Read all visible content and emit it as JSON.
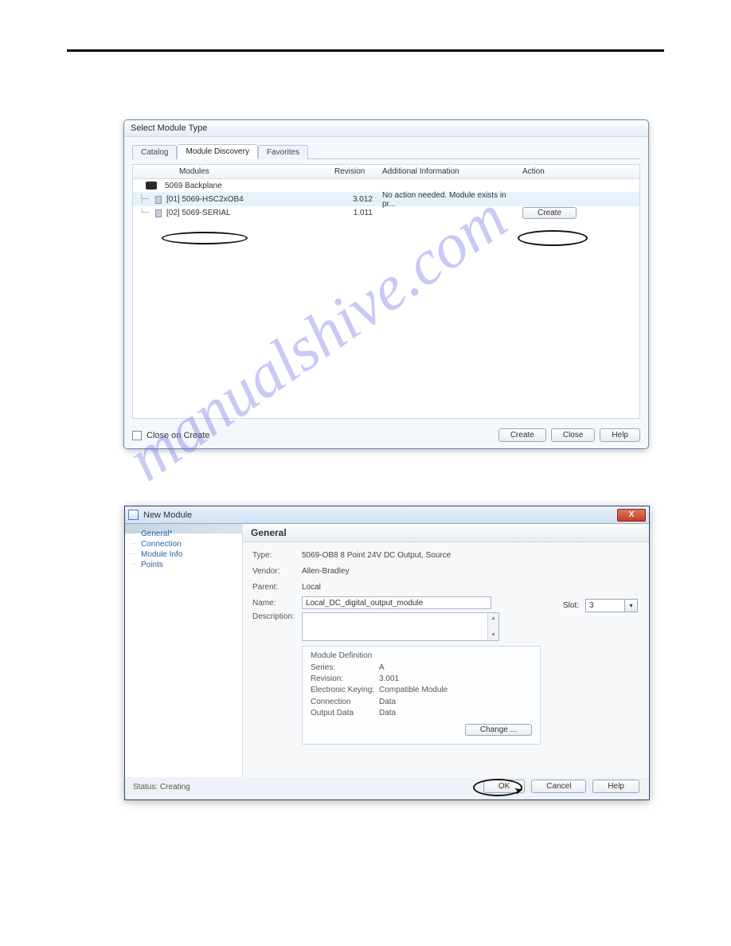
{
  "dlg1": {
    "title": "Select Module Type",
    "tabs": {
      "catalog": "Catalog",
      "discovery": "Module Discovery",
      "favorites": "Favorites"
    },
    "headers": {
      "modules": "Modules",
      "revision": "Revision",
      "info": "Additional Information",
      "action": "Action"
    },
    "backplane": "5069 Backplane",
    "row1": {
      "name": "[01] 5069-HSC2xOB4",
      "rev": "3.012",
      "info": "No action needed. Module exists in pr..."
    },
    "row2": {
      "name": "[02] 5069-SERIAL",
      "rev": "1.011",
      "create_btn": "Create"
    },
    "close_on_create": "Close on Create",
    "buttons": {
      "create": "Create",
      "close": "Close",
      "help": "Help"
    }
  },
  "dlg2": {
    "title": "New Module",
    "nav": {
      "general": "General*",
      "connection": "Connection",
      "module_info": "Module Info",
      "points": "Points"
    },
    "section_head": "General",
    "labels": {
      "type": "Type:",
      "vendor": "Vendor:",
      "parent": "Parent:",
      "name": "Name:",
      "slot": "Slot:",
      "description": "Description:"
    },
    "values": {
      "type": "5069-OB8 8 Point 24V DC Output, Source",
      "vendor": "Allen-Bradley",
      "parent": "Local",
      "name": "Local_DC_digital_output_module",
      "slot": "3"
    },
    "mdef": {
      "title": "Module Definition",
      "series_k": "Series:",
      "series_v": "A",
      "revision_k": "Revision:",
      "revision_v": "3.001",
      "ek_k": "Electronic Keying:",
      "ek_v": "Compatible Module",
      "conn_k": "Connection",
      "conn_v": "Data",
      "out_k": "Output Data",
      "out_v": "Data",
      "change": "Change ..."
    },
    "status_label": "Status:",
    "status_value": "Creating",
    "buttons": {
      "ok": "OK",
      "cancel": "Cancel",
      "help": "Help"
    }
  },
  "watermark": "manualshive.com"
}
